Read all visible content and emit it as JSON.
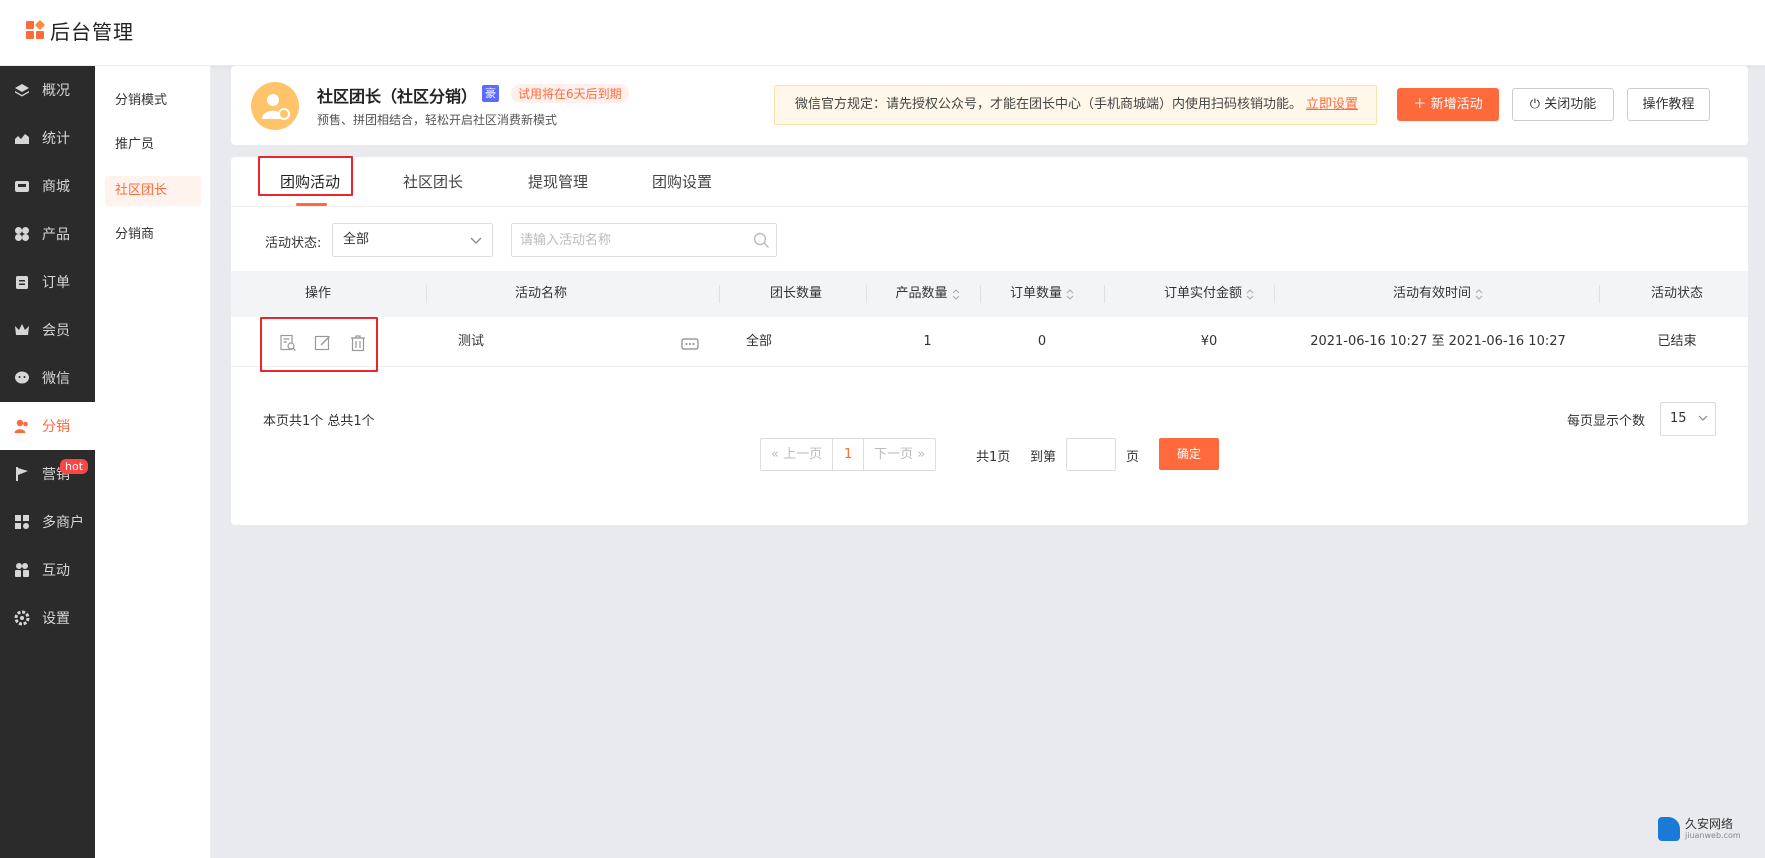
{
  "app": {
    "logo_text": "后台管理"
  },
  "sidebar": {
    "items": [
      {
        "label": "概况",
        "icon": "layers-icon"
      },
      {
        "label": "统计",
        "icon": "chart-icon"
      },
      {
        "label": "商城",
        "icon": "store-icon"
      },
      {
        "label": "产品",
        "icon": "grid-icon"
      },
      {
        "label": "订单",
        "icon": "clipboard-icon"
      },
      {
        "label": "会员",
        "icon": "crown-icon"
      },
      {
        "label": "微信",
        "icon": "wechat-icon"
      },
      {
        "label": "分销",
        "icon": "users-icon",
        "active": true
      },
      {
        "label": "营销",
        "icon": "flag-icon",
        "badge": "hot"
      },
      {
        "label": "多商户",
        "icon": "shop-icon"
      },
      {
        "label": "互动",
        "icon": "people-icon"
      },
      {
        "label": "设置",
        "icon": "gear-icon"
      }
    ]
  },
  "submenu": {
    "items": [
      {
        "label": "分销模式"
      },
      {
        "label": "推广员"
      },
      {
        "label": "社区团长",
        "active": true
      },
      {
        "label": "分销商"
      }
    ]
  },
  "module": {
    "title": "社区团长（社区分销）",
    "vip_badge": "豪",
    "trial_text": "试用将在6天后到期",
    "desc": "预售、拼团相结合，轻松开启社区消费新模式",
    "notice_text": "微信官方规定：请先授权公众号，才能在团长中心（手机商城端）内使用扫码核销功能。",
    "notice_link": "立即设置",
    "btn_new": "新增活动",
    "btn_close": "关闭功能",
    "btn_tutorial": "操作教程"
  },
  "tabs": [
    {
      "label": "团购活动",
      "active": true
    },
    {
      "label": "社区团长"
    },
    {
      "label": "提现管理"
    },
    {
      "label": "团购设置"
    }
  ],
  "filter": {
    "status_label": "活动状态:",
    "status_value": "全部",
    "search_placeholder": "请输入活动名称"
  },
  "table": {
    "columns": [
      "操作",
      "活动名称",
      "团长数量",
      "产品数量",
      "订单数量",
      "订单实付金额",
      "活动有效时间",
      "活动状态"
    ],
    "rows": [
      {
        "name": "测试",
        "leaders": "全部",
        "products": "1",
        "orders": "0",
        "amount": "¥0",
        "time": "2021-06-16 10:27 至 2021-06-16 10:27",
        "status": "已结束"
      }
    ]
  },
  "pagination": {
    "summary": "本页共1个  总共1个",
    "prev": "上一页",
    "current": "1",
    "next": "下一页",
    "total_pages": "共1页",
    "goto_label": "到第",
    "page_unit": "页",
    "confirm": "确定",
    "per_page_label": "每页显示个数",
    "per_page_value": "15"
  },
  "watermark": {
    "name": "久安网络",
    "domain": "jiuanweb.com"
  },
  "colors": {
    "accent": "#ff6a3d",
    "sidebar_bg": "#2b2b2b",
    "highlight_box": "#e8262b"
  }
}
